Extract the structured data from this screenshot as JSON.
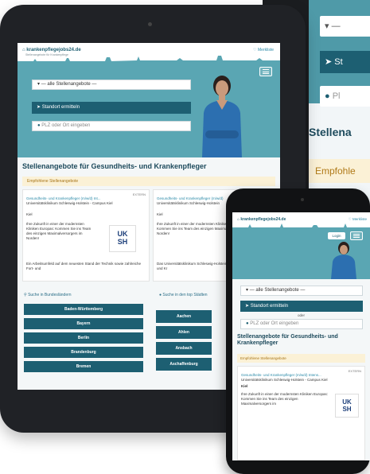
{
  "background_tablet": {
    "select_label": "—",
    "location_button": "St",
    "plz_placeholder": "Pl",
    "section_title": "Stellena",
    "recommended": "Empfohle"
  },
  "tablet": {
    "logo": "krankenpflegejobs24.de",
    "logo_sub": "Stellenangebote für Krankenpflege",
    "merkliste": "♡ Merkliste",
    "select_label": "— alle Stellenangebote —",
    "location_button": "Standort ermitteln",
    "plz_placeholder": "PLZ oder Ort eingeben",
    "section_title": "Stellenangebote für Gesundheits- und Krankenpfleger",
    "recommended": "Empfohlene Stellenangebote",
    "jobs": [
      {
        "ext": "EXTERN",
        "title": "Gesundheits- und Krankenpfleger (m/w/d) Int...",
        "org": "Universitätsklinikum Schleswig-Holstein - Campus Kiel",
        "city": "Kiel",
        "desc": "Ihre Zukunft in einer der modernsten Kliniken Europas: Kommen Sie ins Team des einzigen Maximalversorgers im Norden!",
        "foot": "Ein Arbeitsumfeld auf dem neuesten Stand der Technik sowie zahlreiche Fort- und"
      },
      {
        "title": "Gesundheits- und Krankenpfleger (m/w/d)",
        "org": "Universitätsklinikum Schleswig-Holstein",
        "city": "Kiel",
        "desc": "Ihre Zukunft in einer der modernsten Kliniken Europas: Kommen Sie ins Team des einzigen Maximalversorgers im Norden!",
        "foot": "Das Universitätsklinikum Schleswig-Holstein (UKSH) sucht Gesundheits- und Kr"
      }
    ],
    "logo_uksh": "UK\nSH",
    "states_heading": "Suche in Bundesländern",
    "cities_heading": "Suche in den top Städten",
    "states": [
      "Baden-Württemberg",
      "Bayern",
      "Berlin",
      "Brandenburg",
      "Bremen"
    ],
    "cities": [
      "Aachen",
      "Ahlen",
      "Ansbach",
      "Aschaffenburg"
    ]
  },
  "phone": {
    "logo": "krankenpflegejobs24.de",
    "merkliste": "♡ Merkliste",
    "login": "Login",
    "select_label": "— alle Stellenangebote —",
    "location_button": "Standort ermitteln",
    "or": "oder",
    "plz_placeholder": "PLZ oder Ort eingeben",
    "section_title": "Stellenangebote für Gesundheits- und Krankenpfleger",
    "recommended": "Empfohlene Stellenangebote",
    "job": {
      "ext": "EXTERN",
      "title": "Gesundheits- und Krankenpfleger (m/w/d) Intens...",
      "org": "Universitätsklinikum Schleswig-Holstein - Campus Kiel",
      "city": "Kiel",
      "desc": "Ihre Zukunft in einer der modernsten Kliniken Europas: Kommen Sie ins Team des einzigen Maximalversorgers im"
    },
    "logo_uksh": "UK\nSH"
  },
  "colors": {
    "primary": "#1d5f72",
    "hero": "#5aa6b3",
    "accent_text": "#2b8aa8",
    "recommended_bg": "#fbf1d6"
  }
}
